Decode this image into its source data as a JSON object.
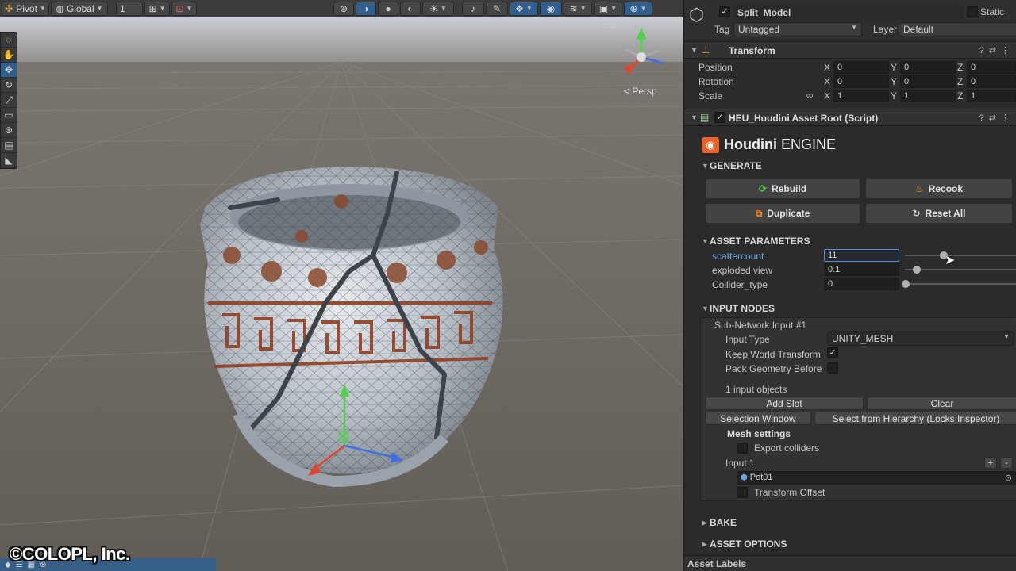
{
  "scene_toolbar": {
    "pivot_label": "Pivot",
    "global_label": "Global",
    "grid_value": "1",
    "persp_label": "Persp"
  },
  "copyright": "©COLOPL, Inc.",
  "object": {
    "name": "Split_Model",
    "static_label": "Static",
    "tag_label": "Tag",
    "tag_value": "Untagged",
    "layer_label": "Layer",
    "layer_value": "Default"
  },
  "transform": {
    "title": "Transform",
    "rows": [
      {
        "label": "Position",
        "x": "0",
        "y": "0",
        "z": "0"
      },
      {
        "label": "Rotation",
        "x": "0",
        "y": "0",
        "z": "0"
      },
      {
        "label": "Scale",
        "x": "1",
        "y": "1",
        "z": "1"
      }
    ],
    "axis_x": "X",
    "axis_y": "Y",
    "axis_z": "Z"
  },
  "houdini": {
    "component_title": "HEU_Houdini Asset Root (Script)",
    "logo_bold": "Houdini",
    "logo_light": "ENGINE",
    "generate_title": "GENERATE",
    "rebuild": "Rebuild",
    "recook": "Recook",
    "duplicate": "Duplicate",
    "reset_all": "Reset All",
    "asset_params_title": "ASSET PARAMETERS",
    "params": [
      {
        "label": "scattercount",
        "value": "11"
      },
      {
        "label": "exploded view",
        "value": "0.1"
      },
      {
        "label": "Collider_type",
        "value": "0"
      }
    ],
    "input_nodes_title": "INPUT NODES",
    "subnet_label": "Sub-Network Input #1",
    "input_type_label": "Input Type",
    "input_type_value": "UNITY_MESH",
    "keep_world_label": "Keep World Transform",
    "pack_geo_label": "Pack Geometry Before M",
    "input_objects_count": "1 input objects",
    "add_slot": "Add Slot",
    "clear": "Clear",
    "selection_window": "Selection Window",
    "select_hierarchy": "Select from Hierarchy (Locks Inspector)",
    "mesh_settings": "Mesh settings",
    "export_colliders": "Export colliders",
    "input1_label": "Input 1",
    "pot_name": "Pot01",
    "transform_offset": "Transform Offset",
    "bake_title": "BAKE",
    "asset_options_title": "ASSET OPTIONS"
  },
  "asset_labels": "Asset Labels",
  "colors": {
    "accent_blue": "#4a90d9",
    "active_blue": "#2f5f8f",
    "houdini_orange": "#e8622a"
  }
}
